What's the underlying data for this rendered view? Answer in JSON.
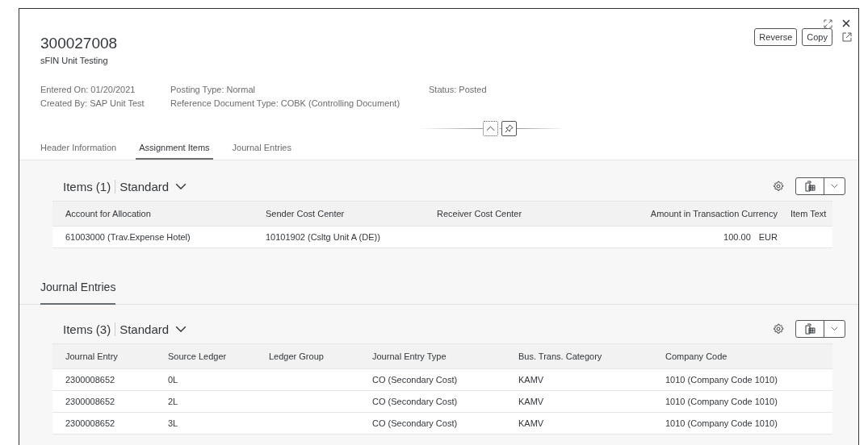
{
  "header": {
    "title": "300027008",
    "subtitle": "sFIN Unit Testing",
    "actions": [
      "Reverse",
      "Copy"
    ],
    "meta": [
      [
        "Entered On: 01/20/2021",
        "Created By: SAP Unit Test"
      ],
      [
        "Posting Type: Normal",
        "Reference Document Type: COBK (Controlling Document)"
      ],
      [
        "Status: Posted"
      ]
    ]
  },
  "tabs": [
    {
      "label": "Header Information",
      "selected": false
    },
    {
      "label": "Assignment Items",
      "selected": true
    },
    {
      "label": "Journal Entries",
      "selected": false
    }
  ],
  "sections": [
    {
      "items_title": "Items (1)",
      "variant": "Standard",
      "columns": [
        "Account for Allocation",
        "Sender Cost Center",
        "Receiver Cost Center",
        "Amount in Transaction Currency",
        "Item Text"
      ],
      "rows": [
        [
          "61003000 (Trav.Expense Hotel)",
          "10101902 (Csltg Unit A (DE))",
          "",
          {
            "amount": "100.00",
            "unit": "EUR"
          },
          ""
        ]
      ]
    },
    {
      "heading": "Journal Entries",
      "items_title": "Items (3)",
      "variant": "Standard",
      "columns": [
        "Journal Entry",
        "Source Ledger",
        "Ledger Group",
        "Journal Entry Type",
        "Bus. Trans. Category",
        "Company Code"
      ],
      "rows": [
        [
          "2300008652",
          "0L",
          "",
          "CO (Secondary Cost)",
          "KAMV",
          "1010 (Company Code 1010)"
        ],
        [
          "2300008652",
          "2L",
          "",
          "CO (Secondary Cost)",
          "KAMV",
          "1010 (Company Code 1010)"
        ],
        [
          "2300008652",
          "3L",
          "",
          "CO (Secondary Cost)",
          "KAMV",
          "1010 (Company Code 1010)"
        ]
      ]
    }
  ]
}
